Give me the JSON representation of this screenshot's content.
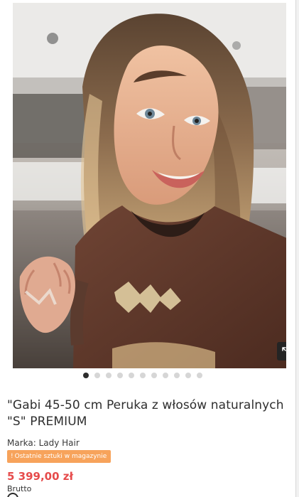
{
  "product": {
    "image_alt": "Gabi wig photo",
    "title": "\"Gabi 45-50 cm Peruka z włosów naturalnych \"S\" PREMIUM",
    "brand_label": "Marka: Lady Hair",
    "stock_icon": "!",
    "stock_badge": "Ostatnie sztuki w magazynie",
    "price": "5 399,00 zł",
    "price_note": "Brutto"
  },
  "gallery": {
    "slide_count": 11,
    "active_slide": 1,
    "zoom_icon": "expand-icon"
  },
  "colors": {
    "price": "#e64b4b",
    "badge": "#f7a35b",
    "dot_active": "#2d2d2d",
    "dot_inactive": "#d6d6d6"
  }
}
